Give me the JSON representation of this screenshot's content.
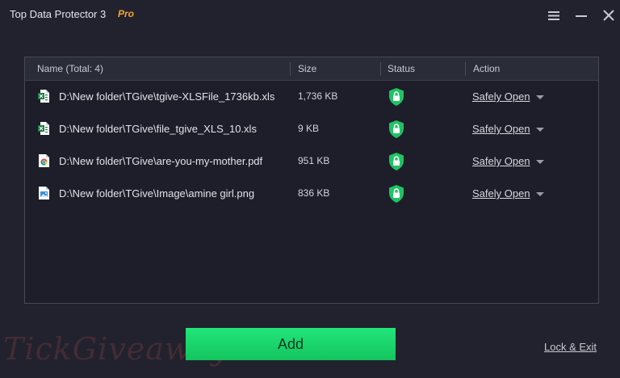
{
  "window": {
    "title": "Top Data Protector 3",
    "edition": "Pro",
    "controls": [
      "menu-icon",
      "minimize-icon",
      "close-icon"
    ]
  },
  "table": {
    "columns": {
      "name": "Name (Total: 4)",
      "size": "Size",
      "status": "Status",
      "action": "Action"
    },
    "rows": [
      {
        "icon": "excel-file-icon",
        "name": "D:\\New folder\\TGive\\tgive-XLSFile_1736kb.xls",
        "size": "1,736 KB",
        "status_icon": "shield-lock-icon",
        "action": "Safely Open"
      },
      {
        "icon": "excel-file-icon",
        "name": "D:\\New folder\\TGive\\file_tgive_XLS_10.xls",
        "size": "9 KB",
        "status_icon": "shield-lock-icon",
        "action": "Safely Open"
      },
      {
        "icon": "chrome-pdf-icon",
        "name": "D:\\New folder\\TGive\\are-you-my-mother.pdf",
        "size": "951 KB",
        "status_icon": "shield-lock-icon",
        "action": "Safely Open"
      },
      {
        "icon": "image-file-icon",
        "name": "D:\\New folder\\TGive\\Image\\amine girl.png",
        "size": "836 KB",
        "status_icon": "shield-lock-icon",
        "action": "Safely Open"
      }
    ]
  },
  "buttons": {
    "add": "Add",
    "lock_exit": "Lock & Exit"
  },
  "watermark": "TickGiveaway",
  "colors": {
    "background": "#21222e",
    "accent_green": "#1fdd6f",
    "pro_orange": "#f5a623"
  }
}
